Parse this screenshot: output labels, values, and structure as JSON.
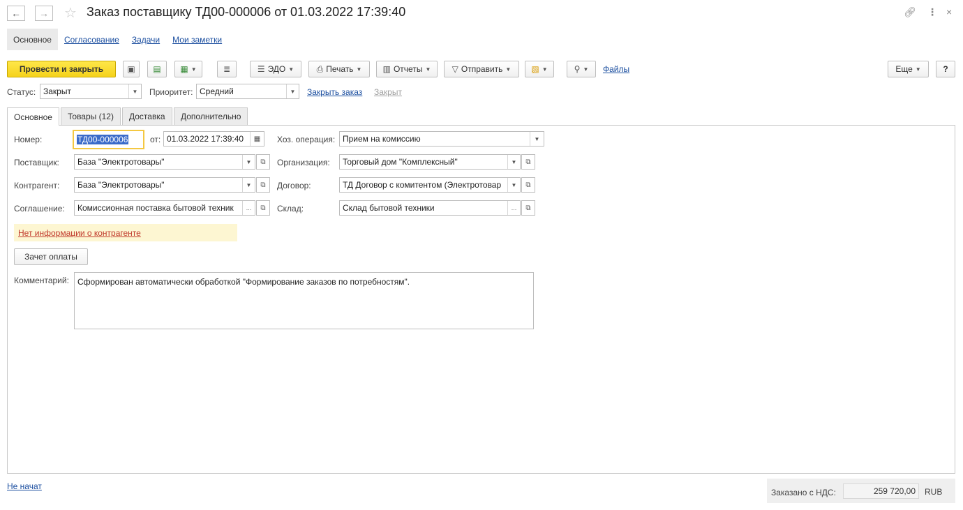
{
  "window": {
    "title": "Заказ поставщику ТД00-000006 от 01.03.2022 17:39:40"
  },
  "section_nav": [
    "Основное",
    "Согласование",
    "Задачи",
    "Мои заметки"
  ],
  "toolbar": {
    "post_and_close": "Провести и закрыть",
    "edo": "ЭДО",
    "print": "Печать",
    "reports": "Отчеты",
    "send": "Отправить",
    "files": "Файлы",
    "more": "Еще",
    "help": "?"
  },
  "status_row": {
    "status_label": "Статус:",
    "status_value": "Закрыт",
    "priority_label": "Приоритет:",
    "priority_value": "Средний",
    "close_order_link": "Закрыть заказ",
    "closed_link": "Закрыт"
  },
  "tabs": [
    "Основное",
    "Товары (12)",
    "Доставка",
    "Дополнительно"
  ],
  "form": {
    "number_label": "Номер:",
    "number_value": "ТД00-000006",
    "from_label": "от:",
    "date_value": "01.03.2022 17:39:40",
    "operation_label": "Хоз. операция:",
    "operation_value": "Прием на комиссию",
    "supplier_label": "Поставщик:",
    "supplier_value": "База \"Электротовары\"",
    "organization_label": "Организация:",
    "organization_value": "Торговый дом \"Комплексный\"",
    "counterparty_label": "Контрагент:",
    "counterparty_value": "База \"Электротовары\"",
    "contract_label": "Договор:",
    "contract_value": "ТД Договор с комитентом (Электротовар",
    "agreement_label": "Соглашение:",
    "agreement_value": "Комиссионная поставка бытовой техник",
    "warehouse_label": "Склад:",
    "warehouse_value": "Склад бытовой техники",
    "no_info_link": "Нет информации о контрагенте",
    "offset_payment_button": "Зачет оплаты",
    "comment_label": "Комментарий:",
    "comment_value": "Сформирован автоматически обработкой \"Формирование заказов по потребностям\"."
  },
  "footer": {
    "status_link": "Не начат",
    "total_label": "Заказано с НДС:",
    "total_value": "259 720,00",
    "currency": "RUB"
  }
}
